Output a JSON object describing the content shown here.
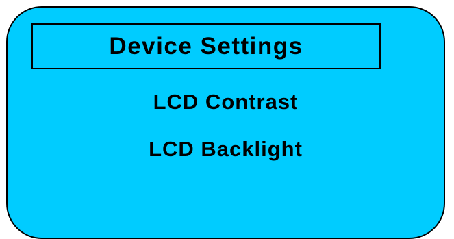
{
  "screen": {
    "background": "#00ccff",
    "border_color": "#000000",
    "title": "Device Settings",
    "menu": {
      "items": [
        {
          "label": "LCD Contrast"
        },
        {
          "label": "LCD Backlight"
        }
      ]
    }
  }
}
